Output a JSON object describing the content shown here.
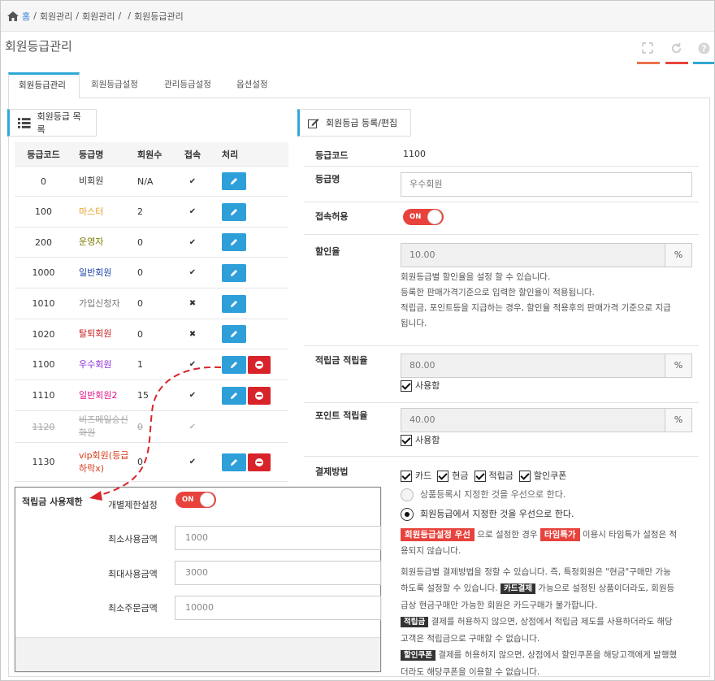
{
  "breadcrumb": {
    "home": "홈",
    "items": [
      "회원관리",
      "회원관리",
      "",
      "회원등급관리"
    ]
  },
  "page_title": "회원등급관리",
  "toolbar": {
    "fullscreen_color": "#e8734a",
    "refresh_color": "#e9433d",
    "help_color": "#2fa8d6"
  },
  "tabs": [
    "회원등급관리",
    "회원등급설정",
    "관리등급설정",
    "옵션설정"
  ],
  "list_panel": {
    "title": "회원등급 목록",
    "headers": [
      "등급코드",
      "등급명",
      "회원수",
      "접속",
      "처리"
    ],
    "rows": [
      {
        "code": "0",
        "name": "비회원",
        "count": "N/A",
        "access": "✔",
        "color": "#333",
        "del": false
      },
      {
        "code": "100",
        "name": "마스터",
        "count": "2",
        "access": "✔",
        "color": "#e8a020",
        "del": false
      },
      {
        "code": "200",
        "name": "운영자",
        "count": "0",
        "access": "✔",
        "color": "#7a7a00",
        "del": false
      },
      {
        "code": "1000",
        "name": "일반회원",
        "count": "0",
        "access": "✔",
        "color": "#1b3fa8",
        "del": false
      },
      {
        "code": "1010",
        "name": "가입신청자",
        "count": "0",
        "access": "✖",
        "color": "#777",
        "del": false
      },
      {
        "code": "1020",
        "name": "탈퇴회원",
        "count": "0",
        "access": "✖",
        "color": "#c81e1e",
        "del": false
      },
      {
        "code": "1100",
        "name": "우수회원",
        "count": "1",
        "access": "✔",
        "color": "#8b2bd6",
        "del": true
      },
      {
        "code": "1110",
        "name": "일반회원2",
        "count": "15",
        "access": "✔",
        "color": "#e0148c",
        "del": true
      },
      {
        "code": "1120",
        "name": "비즈메일승신화원",
        "count": "0",
        "access": "✔",
        "color": "#aaa",
        "del": false,
        "strike": true
      },
      {
        "code": "1130",
        "name": "vip회원(등급하락x)",
        "count": "0",
        "access": "✔",
        "color": "#d63a1a",
        "del": true
      }
    ]
  },
  "form_panel": {
    "title": "회원등급 등록/편집",
    "grade_code_label": "등급코드",
    "grade_code": "1100",
    "grade_name_label": "등급명",
    "grade_name": "우수회원",
    "access_label": "접속허용",
    "toggle_on": "ON",
    "discount_label": "할인율",
    "discount_value": "10.00",
    "percent": "%",
    "discount_help": [
      "회원등급별 할인율을 설정 할 수 있습니다.",
      "등록한 판매가격기준으로 입력한 할인율이 적용됩니다.",
      "적립금, 포인트등을 지급하는 경우, 할인율 적용후의 판매가격 기준으로 지급",
      "됩니다."
    ],
    "reserve_label": "적립금 적립율",
    "reserve_value": "80.00",
    "use_label": "사용함",
    "point_label": "포인트 적립율",
    "point_value": "40.00",
    "payment_label": "결제방법",
    "payment_methods": [
      "카드",
      "현금",
      "적립금",
      "할인쿠폰"
    ],
    "radio_1": "상품등록시 지정한 것을 우선으로 한다.",
    "radio_2": "회원등급에서 지정한 것을 우선으로 한다.",
    "badge_grade": "회원등급설정 우선",
    "text_a": "으로 설정한 경우",
    "badge_timesale": "타임특가",
    "text_b": "이용시 타임특가 설정은 적",
    "text_c": "용되지 않습니다.",
    "pay_help_1": "회원등급별 결제방법을 정할 수 있습니다. 즉, 특정회원은 \"현금\"구매만 가능",
    "pay_help_2a": "하도록 설정할 수 있습니다.",
    "badge_card": "카드결제",
    "pay_help_2b": "가능으로 설정된 상품이더라도, 회원등",
    "pay_help_3": "급상 현금구매만 가능한 회원은 카드구매가 불가합니다.",
    "badge_reserve": "적립금",
    "pay_help_4": "결제를 허용하지 않으면, 상점에서 적립금 제도를 사용하더라도 해당",
    "pay_help_5": "고객은 적립금으로 구매할 수 없습니다.",
    "badge_coupon": "할인쿠폰",
    "pay_help_6": "결제를 허용하지 않으면, 상점에서 할인쿠폰을 해당고객에게 발행했",
    "pay_help_7": "더라도 해당쿠폰을 이용할 수 없습니다."
  },
  "popup": {
    "annotation": "적립금 사용제한",
    "individual_label": "개별제한설정",
    "toggle_on": "ON",
    "min_use_label": "최소사용금액",
    "min_use_value": "1000",
    "max_use_label": "최대사용금액",
    "max_use_value": "3000",
    "min_order_label": "최소주문금액",
    "min_order_value": "10000"
  }
}
